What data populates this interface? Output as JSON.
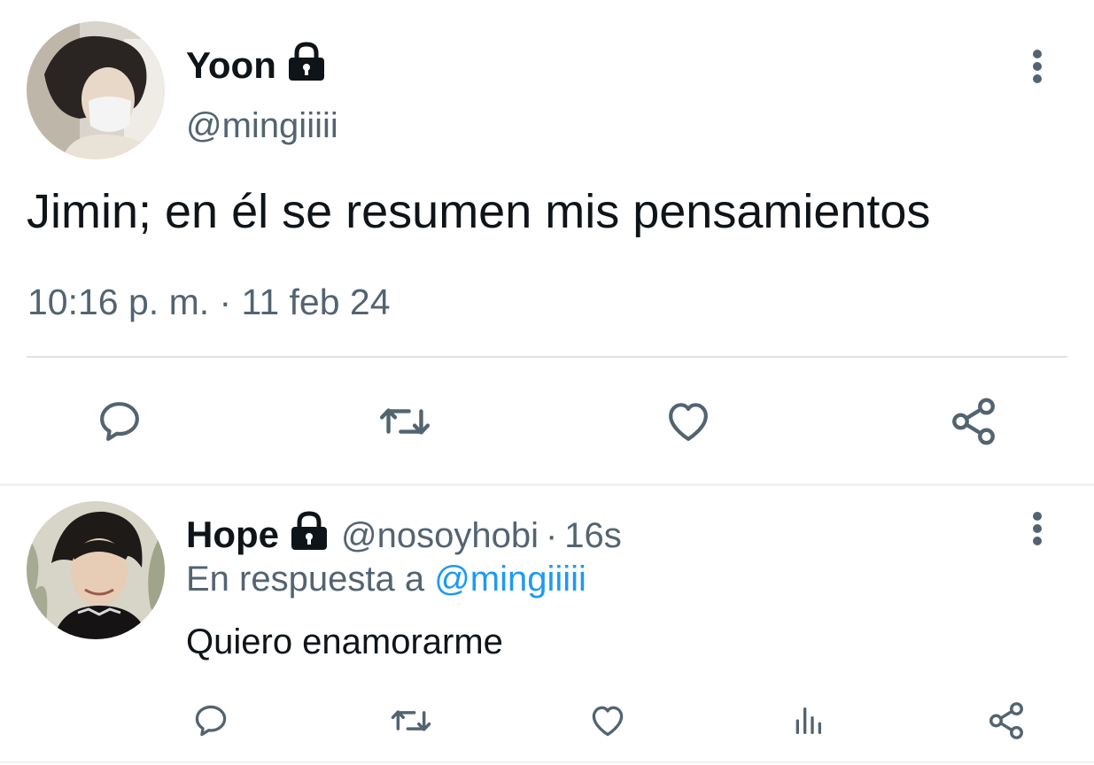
{
  "main_tweet": {
    "display_name": "Yoon",
    "handle": "@mingiiiii",
    "text": "Jimin; en él se resumen mis pensamientos",
    "timestamp": "10:16 p. m. · 11 feb 24",
    "actions": [
      "reply-icon",
      "retweet-icon",
      "like-icon",
      "share-icon"
    ]
  },
  "reply_tweet": {
    "display_name": "Hope",
    "handle": "@nosoyhobi",
    "separator": "·",
    "time_ago": "16s",
    "reply_prefix": "En respuesta a",
    "reply_mention": "@mingiiiii",
    "text": "Quiero enamorarme",
    "actions": [
      "reply-icon",
      "retweet-icon",
      "like-icon",
      "analytics-icon",
      "share-icon"
    ]
  },
  "colors": {
    "text": "#0f1419",
    "secondary": "#536471",
    "accent": "#1d9bf0",
    "divider": "#dfe3e6"
  }
}
